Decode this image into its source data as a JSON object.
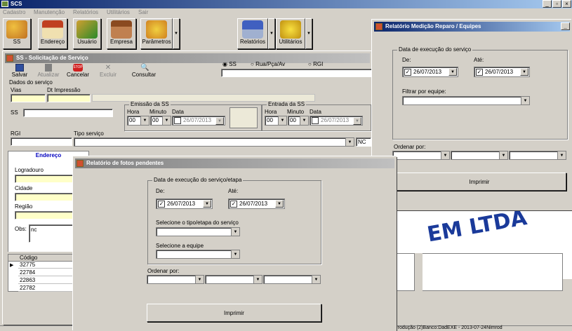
{
  "app": {
    "title": "SCS"
  },
  "menu": [
    "Cadastro",
    "Manutenção",
    "Relatórios",
    "Utilitários",
    "Sair"
  ],
  "toolbar": {
    "ss": "SS",
    "endereco": "Endereço",
    "usuario": "Usuário",
    "empresa": "Empresa",
    "parametros": "Parâmetros",
    "relatorios": "Relatórios",
    "utilitarios": "Utilitários"
  },
  "ss_window": {
    "title": "SS - Solicitação de Serviço",
    "actions": {
      "salvar": "Salvar",
      "atualizar": "Atualizar",
      "cancelar": "Cancelar",
      "stop": "STOP",
      "excluir": "Excluir",
      "consultar": "Consultar"
    },
    "radios": [
      "SS",
      "Rua/Pça/Av",
      "RGI"
    ],
    "dados_title": "Dados do serviço",
    "vias": "Vias",
    "dt_impressao": "Dt Impressão",
    "ss_label": "SS",
    "emissao": {
      "title": "Emissão da SS",
      "hora": "Hora",
      "minuto": "Minuto",
      "data": "Data",
      "hora_val": "00",
      "min_val": "00",
      "date": "26/07/2013"
    },
    "entrada": {
      "title": "Entrada da SS",
      "hora": "Hora",
      "minuto": "Minuto",
      "data": "Data",
      "hora_val": "00",
      "min_val": "00",
      "date": "26/07/2013"
    },
    "rgi": "RGI",
    "tipo_servico": "Tipo serviço",
    "nc": "NC",
    "tab_endereco": "Endereço",
    "logradouro": "Logradouro",
    "cidade": "Cidade",
    "regiao": "Região",
    "obs": "Obs:",
    "obs_val": "nc",
    "grid": {
      "header": "Código",
      "rows": [
        "32775",
        "22784",
        "22863",
        "22782"
      ]
    },
    "logo_text": "EM LTDA"
  },
  "fotos": {
    "title": "Relatório de fotos pendentes",
    "group": "Data de execução do serviço/etapa",
    "de": "De:",
    "ate": "Até:",
    "de_val": "26/07/2013",
    "ate_val": "26/07/2013",
    "tipo": "Selecione o tipo/etapa do serviço",
    "equipe": "Selecione a equipe",
    "ordenar": "Ordenar por:",
    "imprimir": "Imprimir"
  },
  "medicao": {
    "title": "Relatório Medição Reparo / Equipes",
    "group": "Data de execução do serviço",
    "de": "De:",
    "ate": "Até:",
    "de_val": "26/07/2013",
    "ate_val": "26/07/2013",
    "filtrar": "Filtrar por equipe:",
    "ordenar": "Ordenar por:",
    "imprimir": "Imprimir"
  },
  "status": {
    "text": "/Produção (2)Banco:DadEXE - 2013-07-24Nimrod"
  }
}
